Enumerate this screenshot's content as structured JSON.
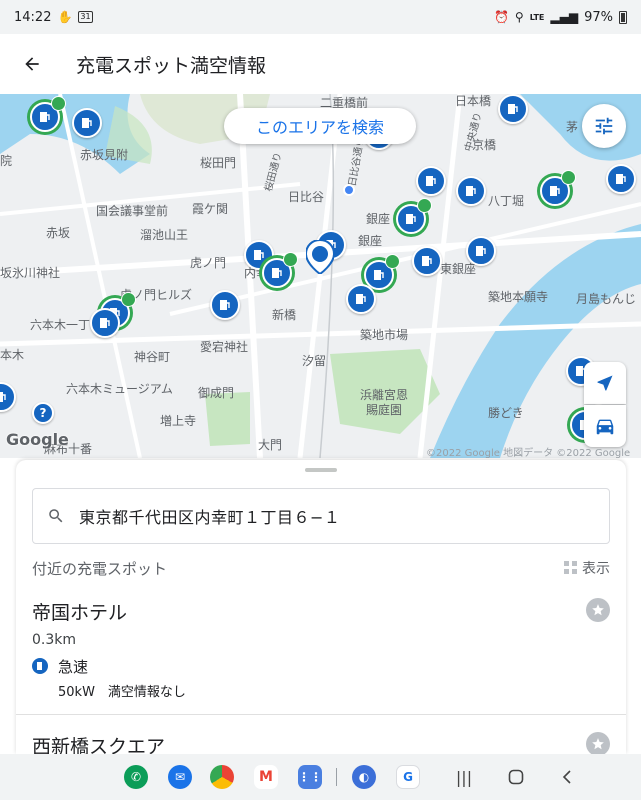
{
  "status_bar": {
    "time": "14:22",
    "calendar_badge": "31",
    "network": "LTE",
    "battery": "97%"
  },
  "app_bar": {
    "title": "充電スポット満空情報"
  },
  "map": {
    "search_area_label": "このエリアを検索",
    "attribution": "©2022 Google 地図データ ©2022 Google",
    "google_logo": "Google",
    "labels": {
      "nijubashimae": "二重橋前",
      "nihonbashi": "日本橋",
      "akasakamitsuke": "赤坂見附",
      "sakuradamon": "桜田門",
      "kyobashi": "京橋",
      "hibiya": "日比谷",
      "kokkaigijidomae": "国会議事堂前",
      "kasumigaseki": "霞ケ関",
      "hatchobori": "八丁堀",
      "akasaka": "赤坂",
      "tameikesanno": "溜池山王",
      "ginza_1": "銀座",
      "ginza_2": "銀座",
      "higashiginza": "東銀座",
      "toranomon": "虎ノ門",
      "uchisaiwaicho": "内幸町",
      "akasakahikawa": "坂氷川神社",
      "toranomonhills": "虎ノ門ヒルズ",
      "tsukijihonganji": "築地本願寺",
      "tsukishima": "月島もんじ",
      "roppongi1": "六本木一丁",
      "shinbashi": "新橋",
      "tsukijishijo": "築地市場",
      "atagojinja": "愛宕神社",
      "kamiyacho": "神谷町",
      "shiodome": "汐留",
      "hamarikyu": "浜離宮恩賜庭園",
      "roppongi_museum": "六本木ミュージアム",
      "onarimon": "御成門",
      "kachidoki": "勝どき",
      "zojoji": "増上寺",
      "daimon": "大門",
      "azabujuban": "麻布十番",
      "road_sakurada": "桜田通り",
      "road_hibiya": "日比谷通り",
      "road_chuo": "中央通り",
      "hospital": "院",
      "ikejiri": "本木",
      "kayabacho": "茅"
    },
    "colors": {
      "pin": "#1565c0",
      "available_ring": "#34a853",
      "water": "#9dd4f0",
      "park": "#c7e6c1"
    }
  },
  "sheet": {
    "search_value": "東京都千代田区内幸町１丁目６−１",
    "nearby_title": "付近の充電スポット",
    "display_label": "表示",
    "spots": [
      {
        "name": "帝国ホテル",
        "distance": "0.3km",
        "charger_type": "急速",
        "charger_info": "50kW　満空情報なし"
      },
      {
        "name": "西新橋スクエア"
      }
    ]
  }
}
